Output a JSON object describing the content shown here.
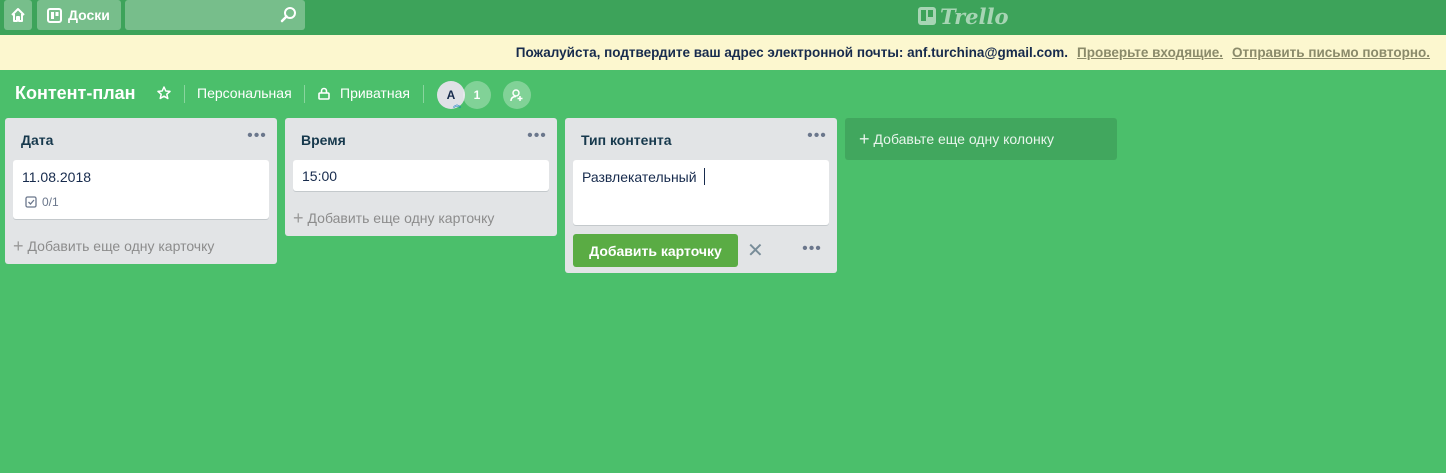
{
  "header": {
    "boards_label": "Доски",
    "search_value": "",
    "logo_text": "Trello"
  },
  "banner": {
    "message": "Пожалуйста, подтвердите ваш адрес электронной почты: anf.turchina@gmail.com.",
    "check_inbox": "Проверьте входящие.",
    "resend": "Отправить письмо повторно."
  },
  "board": {
    "title": "Контент-план",
    "team": "Персональная",
    "visibility": "Приватная",
    "member_initial": "A",
    "member_count": "1"
  },
  "lists": [
    {
      "title": "Дата",
      "cards": [
        {
          "text": "11.08.2018",
          "checklist": "0/1"
        }
      ],
      "add_card": "Добавить еще одну карточку"
    },
    {
      "title": "Время",
      "cards": [
        {
          "text": "15:00"
        }
      ],
      "add_card": "Добавить еще одну карточку"
    },
    {
      "title": "Тип контента",
      "composer_value": "Развлекательный",
      "add_button": "Добавить карточку"
    }
  ],
  "add_list": "Добавьте еще одну колонку",
  "colors": {
    "background": "#4bbf6b",
    "header": "#3da35a",
    "banner": "#fcf7cf",
    "add_button": "#5aac44"
  },
  "icons": {
    "home": "home-icon",
    "boards": "boards-icon",
    "search": "search-icon",
    "star": "star-icon",
    "lock": "lock-icon",
    "add_member": "add-member-icon",
    "checklist": "checklist-icon",
    "close": "close-icon",
    "more": "more-icon"
  }
}
